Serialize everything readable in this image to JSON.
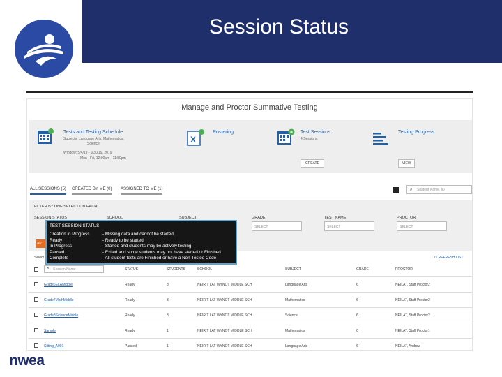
{
  "slide": {
    "title": "Session Status",
    "footer_logo": "nwea"
  },
  "app": {
    "heading": "Manage and Proctor Summative Testing",
    "cards": [
      {
        "title": "Tests and Testing Schedule",
        "line1": "Subjects: Language Arts, Mathematics,",
        "line2": "Science",
        "line3": "Window: 5/4/19 - 9/30/19, 2019",
        "line4": "Mon - Fri, 12:00am - 11:59pm"
      },
      {
        "title": "Rostering"
      },
      {
        "title": "Test Sessions",
        "line1": "4 Sessions",
        "button": "CREATE"
      },
      {
        "title": "Testing Progress",
        "button": "VIEW"
      }
    ],
    "tabs": [
      "ALL SESSIONS (5)",
      "CREATED BY ME (0)",
      "ASSIGNED TO ME (1)"
    ],
    "student_search_placeholder": "Student Name, ID",
    "filter": {
      "heading": "FILTER BY ONE SELECTION EACH:",
      "labels": [
        "SESSION STATUS",
        "SCHOOL",
        "SUBJECT",
        "GRADE",
        "TEST NAME",
        "PROCTOR"
      ],
      "select_placeholder": "SELECT",
      "orange_button": "AP"
    },
    "tooltip": {
      "heading": "TEST SESSION STATUS",
      "rows": [
        {
          "status": "Creation in Progress",
          "desc": "- Missing data and cannot be started"
        },
        {
          "status": "Ready",
          "desc": "- Ready to be started"
        },
        {
          "status": "In Progress",
          "desc": "- Started and students may be actively testing"
        },
        {
          "status": "Paused",
          "desc": "- Exited and some students may not have started or Finished"
        },
        {
          "status": "Complete",
          "desc": "- All student tests are Finished or have a Non-Tested Code"
        }
      ]
    },
    "table": {
      "select_label": "Select",
      "refresh": "REFRESH LIST",
      "search_placeholder": "Session Name",
      "headers": [
        "STATUS",
        "STUDENTS",
        "SCHOOL",
        "SUBJECT",
        "GRADE",
        "PROCTOR"
      ],
      "rows": [
        {
          "name": "Grade6ELAMiddle",
          "status": "Ready",
          "students": "3",
          "school": "NEIRIT LAT WYNOT MIDDLE SCH",
          "subject": "Language Arts",
          "grade": "6",
          "proctor": "NEILAT, Staff Proctor2"
        },
        {
          "name": "Grade7MathMiddle",
          "status": "Ready",
          "students": "3",
          "school": "NEIRIT LAT WYNOT MIDDLE SCH",
          "subject": "Mathematics",
          "grade": "6",
          "proctor": "NEILAT, Staff Proctor2"
        },
        {
          "name": "Grade8ScienceMiddle",
          "status": "Ready",
          "students": "3",
          "school": "NEIRIT LAT WYNOT MIDDLE SCH",
          "subject": "Science",
          "grade": "6",
          "proctor": "NEILAT, Staff Proctor2"
        },
        {
          "name": "Sample",
          "status": "Ready",
          "students": "1",
          "school": "NEIRIT LAT WYNOT MIDDLE SCH",
          "subject": "Mathematics",
          "grade": "6",
          "proctor": "NEILAT, Staff Proctor1"
        },
        {
          "name": "Sitting_A001",
          "status": "Paused",
          "students": "1",
          "school": "NEIRIT LAT WYNOT MIDDLE SCH",
          "subject": "Language Arts",
          "grade": "6",
          "proctor": "NEILAT, Andrew"
        }
      ]
    }
  }
}
